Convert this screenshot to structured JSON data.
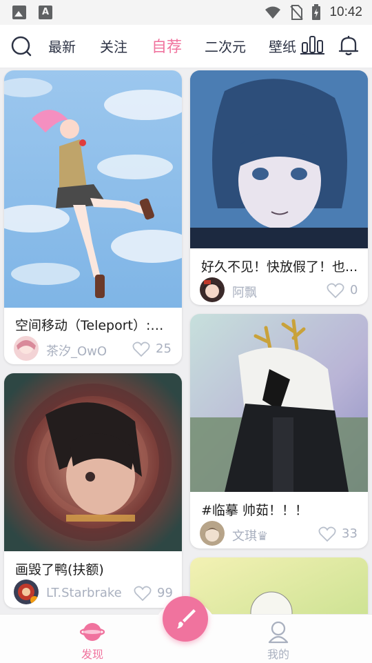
{
  "status_bar": {
    "time": "10:42"
  },
  "nav": {
    "tabs": [
      {
        "label": "最新"
      },
      {
        "label": "关注"
      },
      {
        "label": "自荐"
      },
      {
        "label": "二次元"
      },
      {
        "label": "壁纸"
      }
    ],
    "active_tab": "自荐",
    "accent_color": "#f0739e"
  },
  "cards": [
    {
      "title": "空间移动（Teleport）:跳跃奔跑",
      "author": "茶汐_OwO",
      "likes": "25"
    },
    {
      "title": "好久不见！快放假了！也...",
      "author": "阿飘",
      "likes": "0"
    },
    {
      "title": "画毁了鸭(扶额)",
      "author": "LT.Starbrake",
      "likes": "99"
    },
    {
      "title": "#临摹 帅茹！！！",
      "author": "文琪♛",
      "likes": "33"
    }
  ],
  "bottom_nav": {
    "discover_label": "发现",
    "mine_label": "我的"
  }
}
